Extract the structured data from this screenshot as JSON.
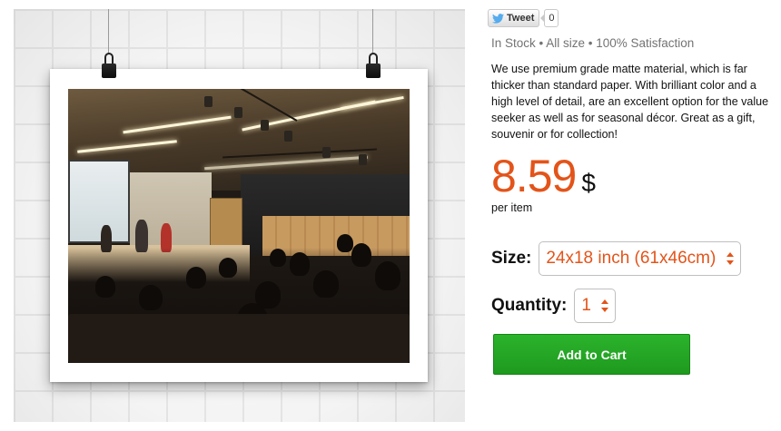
{
  "social": {
    "tweet_label": "Tweet",
    "tweet_count": "0"
  },
  "product": {
    "stock_info": "In Stock • All size • 100% Satisfaction",
    "description": "We use premium grade matte material, which is far thicker than standard paper. With brilliant color and a high level of detail, are an excellent option for the value seeker as well as for seasonal décor. Great as a gift, souvenir or for collection!",
    "price": "8.59",
    "currency": "$",
    "price_unit": "per item",
    "image_alt_icon": "poster-photo"
  },
  "options": {
    "size_label": "Size:",
    "size_value": "24x18 inch (61x46cm)",
    "quantity_label": "Quantity:",
    "quantity_value": "1"
  },
  "actions": {
    "add_to_cart_label": "Add to Cart"
  },
  "colors": {
    "price_orange": "#e3541a",
    "cart_green": "#1e9a1e",
    "twitter_blue": "#55acee"
  }
}
